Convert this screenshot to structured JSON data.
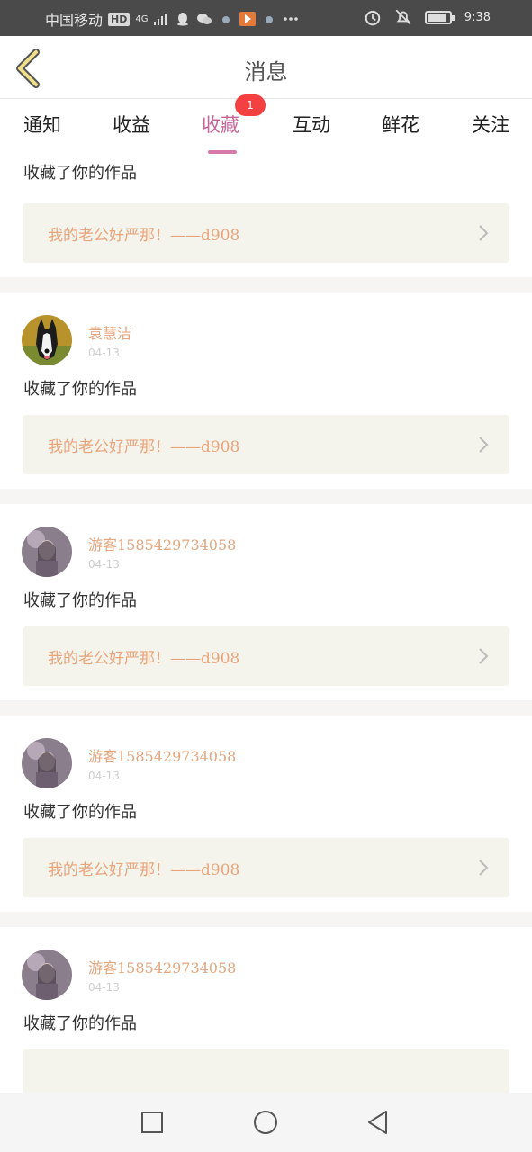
{
  "status_bar": {
    "carrier": "中国移动",
    "hd_badge": "HD",
    "network": "4G",
    "time": "9:38",
    "battery_level": 0.85,
    "icons": [
      "signal-icon",
      "qq-icon",
      "wechat-icon",
      "app-icon",
      "more-icon",
      "alarm-icon",
      "mute-icon",
      "battery-icon"
    ]
  },
  "header": {
    "title": "消息"
  },
  "tabs": {
    "items": [
      {
        "label": "通知"
      },
      {
        "label": "收益"
      },
      {
        "label": "收藏"
      },
      {
        "label": "互动"
      },
      {
        "label": "鲜花"
      },
      {
        "label": "关注"
      }
    ],
    "active_index": 2,
    "badge": "1",
    "accent": "#c6679a"
  },
  "feed": {
    "first_partial": {
      "action": "收藏了你的作品",
      "work": "我的老公好严那！——d908"
    },
    "items": [
      {
        "name": "袁慧洁",
        "date": "04-13",
        "action": "收藏了你的作品",
        "work": "我的老公好严那！——d908",
        "avatar": "dog"
      },
      {
        "name": "游客1585429734058",
        "date": "04-13",
        "action": "收藏了你的作品",
        "work": "我的老公好严那！——d908",
        "avatar": "girl"
      },
      {
        "name": "游客1585429734058",
        "date": "04-13",
        "action": "收藏了你的作品",
        "work": "我的老公好严那！——d908",
        "avatar": "girl"
      },
      {
        "name": "游客1585429734058",
        "date": "04-13",
        "action": "收藏了你的作品",
        "work": "",
        "avatar": "girl"
      }
    ]
  },
  "colors": {
    "name": "#e5a67d",
    "work_bg": "#f4f4ec",
    "work_text": "#eaa47c",
    "badge": "#f44040"
  }
}
